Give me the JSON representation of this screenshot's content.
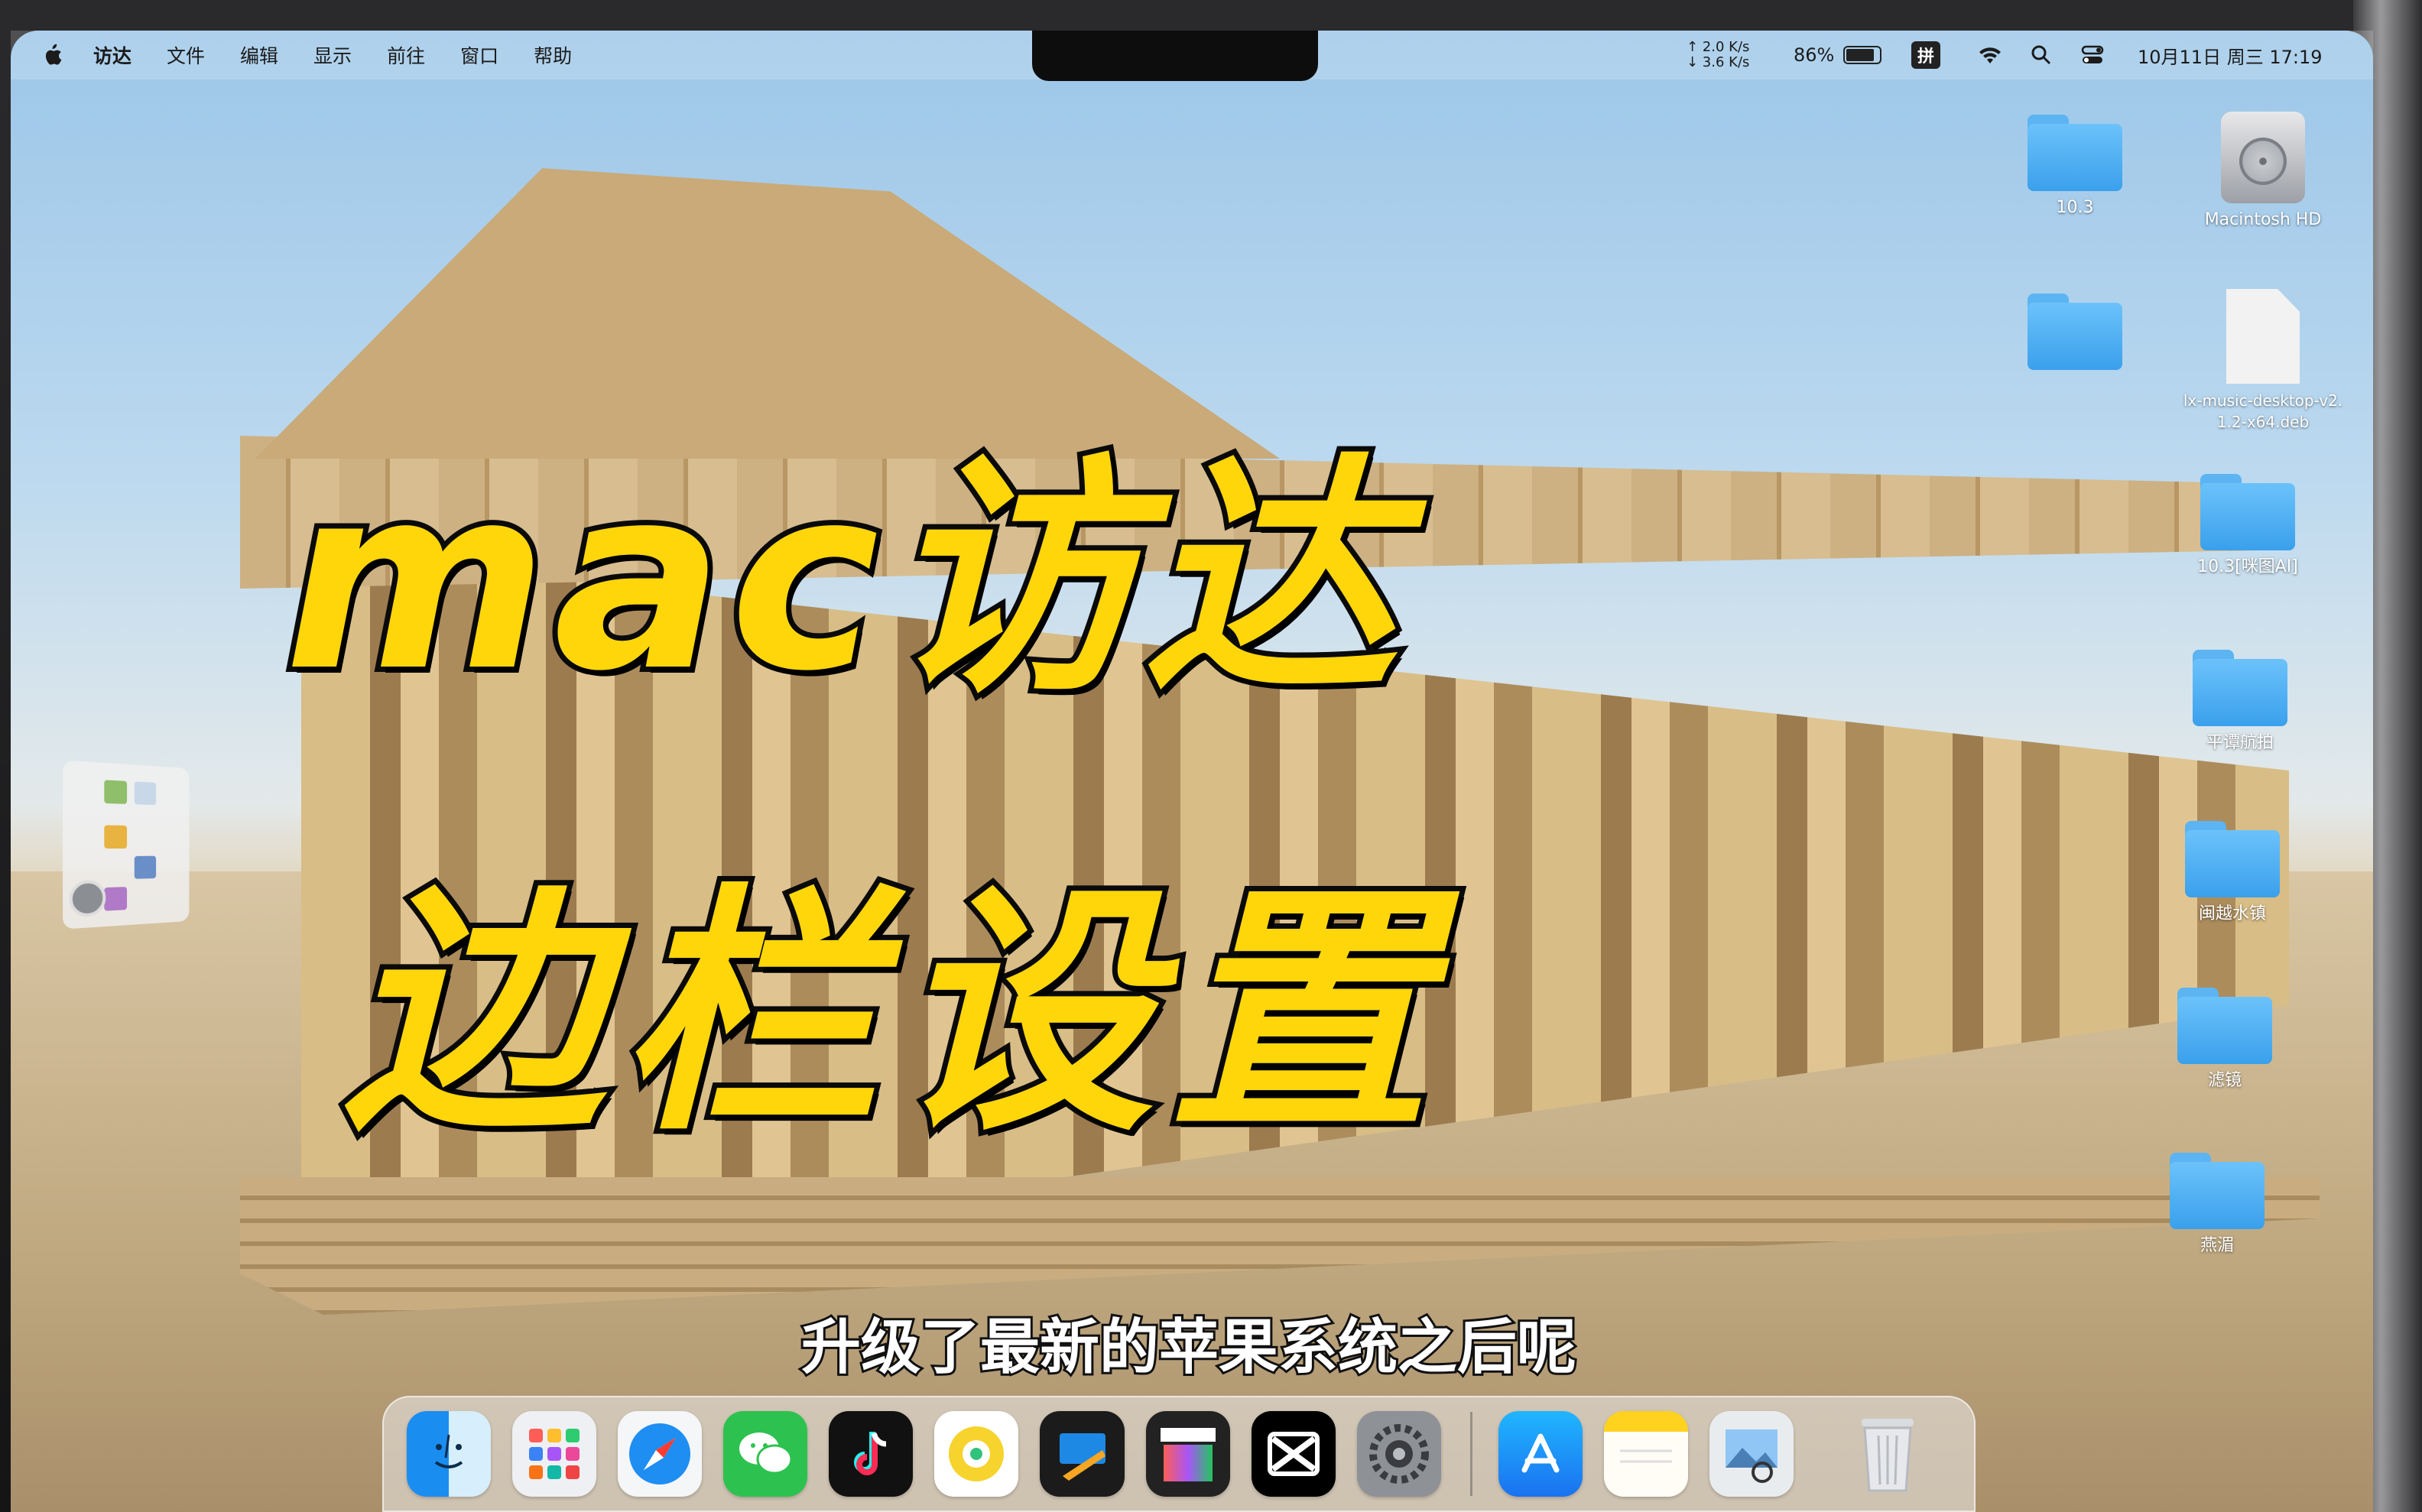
{
  "menubar": {
    "items": [
      "访达",
      "文件",
      "编辑",
      "显示",
      "前往",
      "窗口",
      "帮助"
    ]
  },
  "status": {
    "net_up": "↑ 2.0 K/s",
    "net_down": "↓ 3.6 K/s",
    "battery_percent": "86%",
    "battery_level": 0.86,
    "ime": "拼",
    "datetime": "10月11日 周三  17:19"
  },
  "desktop": {
    "folder_1": "10.3",
    "disk": "Macintosh HD",
    "deb_file": "lx-music-desktop-v2.1.2-x64.deb",
    "folder_3": "10.3[咪图AI]",
    "folder_4": "平谭航拍",
    "folder_5": "闽越水镇",
    "folder_6": "滤镜",
    "folder_7": "燕湄"
  },
  "overlay": {
    "title_line_1": "mac访达",
    "title_line_2": "边栏设置",
    "subtitle": "升级了最新的苹果系统之后呢"
  },
  "dock": {
    "apps": [
      "finder",
      "launchpad",
      "safari",
      "wechat",
      "douyin",
      "qq-music",
      "keynote",
      "final-cut-pro",
      "capcut",
      "system-settings",
      "app-store",
      "notes",
      "preview",
      "trash"
    ]
  },
  "colors": {
    "title_fill": "#ffd60a",
    "title_stroke": "#0a0a0a",
    "folder_blue": "#3aa0ec"
  }
}
